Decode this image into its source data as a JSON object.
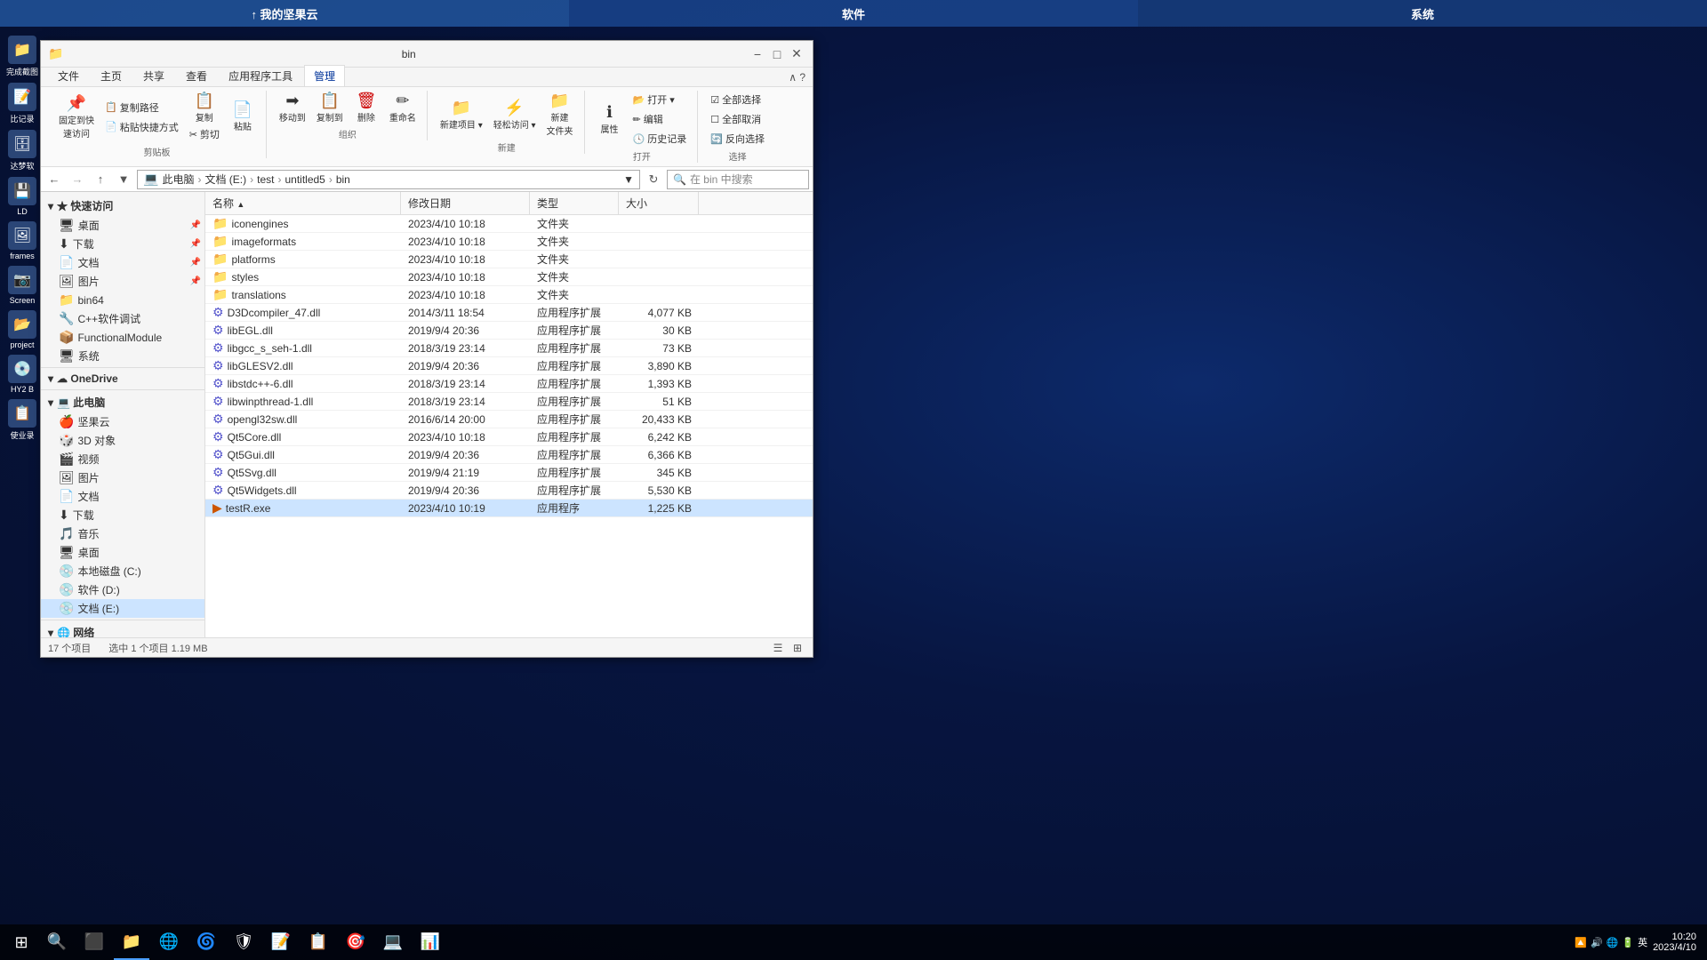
{
  "desktop": {
    "bg_gradient": "radial-gradient(ellipse at 70% 40%, #0d2a6b 0%, #071540 40%, #050e2a 100%)"
  },
  "taskbar_top": {
    "items": [
      {
        "label": "↑ 我的坚果云",
        "class": "jianguoyun"
      },
      {
        "label": "软件",
        "class": "software"
      },
      {
        "label": "系统",
        "class": "system"
      }
    ]
  },
  "desktop_icons": [
    {
      "icon": "📁",
      "label": "完成截图"
    },
    {
      "icon": "🔤",
      "label": "比记录"
    },
    {
      "icon": "💾",
      "label": "达梦软"
    },
    {
      "icon": "📂",
      "label": "LD"
    },
    {
      "icon": "🖼",
      "label": "frames"
    },
    {
      "icon": "📷",
      "label": "Screen"
    },
    {
      "icon": "📁",
      "label": "project"
    },
    {
      "icon": "💿",
      "label": "HY2 B"
    },
    {
      "icon": "💻",
      "label": "使业录"
    }
  ],
  "window": {
    "title": "bin",
    "ribbon": {
      "tabs": [
        "文件",
        "主页",
        "共享",
        "查看",
        "应用程序工具",
        "管理"
      ],
      "active_tab": "管理",
      "groups": [
        {
          "label": "剪贴板",
          "buttons": [
            {
              "icon": "📌",
              "label": "固定到快\n速访问"
            },
            {
              "icon": "📋",
              "label": "复制"
            },
            {
              "icon": "📄",
              "label": "粘贴"
            }
          ]
        },
        {
          "label": "组织",
          "buttons": [
            {
              "icon": "→📁",
              "label": "移动到"
            },
            {
              "icon": "📋→",
              "label": "复制到"
            },
            {
              "icon": "🗑",
              "label": "删除"
            },
            {
              "icon": "✏",
              "label": "重命名"
            }
          ]
        },
        {
          "label": "新建",
          "buttons": [
            {
              "icon": "📁+",
              "label": "新建\n文件夹"
            }
          ]
        },
        {
          "label": "打开",
          "buttons": [
            {
              "icon": "📂",
              "label": "打开▾"
            },
            {
              "icon": "✏",
              "label": "编辑"
            },
            {
              "icon": "🕓",
              "label": "历史记录"
            }
          ]
        },
        {
          "label": "选择",
          "buttons": [
            {
              "icon": "☑",
              "label": "全部选择"
            },
            {
              "icon": "☐",
              "label": "全部取消"
            },
            {
              "icon": "🔄",
              "label": "反向选择"
            }
          ]
        }
      ]
    },
    "address_bar": {
      "path": [
        "此电脑",
        "文档 (E:)",
        "test",
        "untitled5",
        "bin"
      ],
      "search_placeholder": "在 bin 中搜索"
    },
    "nav_pane": {
      "sections": [
        {
          "label": "★ 快速访问",
          "items": [
            {
              "icon": "🖥",
              "label": "桌面",
              "pinned": true
            },
            {
              "icon": "⬇",
              "label": "下载",
              "pinned": true
            },
            {
              "icon": "📄",
              "label": "文档",
              "pinned": true
            },
            {
              "icon": "🖼",
              "label": "图片",
              "pinned": true
            },
            {
              "icon": "📁",
              "label": "bin64"
            },
            {
              "icon": "🔧",
              "label": "C++软件调试"
            },
            {
              "icon": "📦",
              "label": "FunctionalModule"
            },
            {
              "icon": "🖥",
              "label": "系统"
            }
          ]
        },
        {
          "label": "☁ OneDrive",
          "items": []
        },
        {
          "label": "💻 此电脑",
          "items": [
            {
              "icon": "🍎",
              "label": "坚果云"
            },
            {
              "icon": "🎲",
              "label": "3D 对象"
            },
            {
              "icon": "🎬",
              "label": "视频"
            },
            {
              "icon": "🖼",
              "label": "图片"
            },
            {
              "icon": "📄",
              "label": "文档"
            },
            {
              "icon": "⬇",
              "label": "下载"
            },
            {
              "icon": "🎵",
              "label": "音乐"
            },
            {
              "icon": "🖥",
              "label": "桌面"
            },
            {
              "icon": "💿",
              "label": "本地磁盘 (C:)"
            },
            {
              "icon": "💿",
              "label": "软件 (D:)"
            },
            {
              "icon": "💿",
              "label": "文档 (E:)",
              "selected": true
            }
          ]
        },
        {
          "label": "🌐 网络",
          "items": []
        }
      ]
    },
    "file_list": {
      "columns": [
        "名称",
        "修改日期",
        "类型",
        "大小"
      ],
      "files": [
        {
          "icon": "📁",
          "name": "iconengines",
          "date": "2023/4/10 10:18",
          "type": "文件夹",
          "size": "",
          "type_class": "folder"
        },
        {
          "icon": "📁",
          "name": "imageformats",
          "date": "2023/4/10 10:18",
          "type": "文件夹",
          "size": "",
          "type_class": "folder"
        },
        {
          "icon": "📁",
          "name": "platforms",
          "date": "2023/4/10 10:18",
          "type": "文件夹",
          "size": "",
          "type_class": "folder"
        },
        {
          "icon": "📁",
          "name": "styles",
          "date": "2023/4/10 10:18",
          "type": "文件夹",
          "size": "",
          "type_class": "folder"
        },
        {
          "icon": "📁",
          "name": "translations",
          "date": "2023/4/10 10:18",
          "type": "文件夹",
          "size": "",
          "type_class": "folder"
        },
        {
          "icon": "⚙",
          "name": "D3Dcompiler_47.dll",
          "date": "2014/3/11 18:54",
          "type": "应用程序扩展",
          "size": "4,077 KB",
          "type_class": "dll"
        },
        {
          "icon": "⚙",
          "name": "libEGL.dll",
          "date": "2019/9/4 20:36",
          "type": "应用程序扩展",
          "size": "30 KB",
          "type_class": "dll"
        },
        {
          "icon": "⚙",
          "name": "libgcc_s_seh-1.dll",
          "date": "2018/3/19 23:14",
          "type": "应用程序扩展",
          "size": "73 KB",
          "type_class": "dll"
        },
        {
          "icon": "⚙",
          "name": "libGLESV2.dll",
          "date": "2019/9/4 20:36",
          "type": "应用程序扩展",
          "size": "3,890 KB",
          "type_class": "dll"
        },
        {
          "icon": "⚙",
          "name": "libstdc++-6.dll",
          "date": "2018/3/19 23:14",
          "type": "应用程序扩展",
          "size": "1,393 KB",
          "type_class": "dll"
        },
        {
          "icon": "⚙",
          "name": "libwinpthread-1.dll",
          "date": "2018/3/19 23:14",
          "type": "应用程序扩展",
          "size": "51 KB",
          "type_class": "dll"
        },
        {
          "icon": "⚙",
          "name": "opengl32sw.dll",
          "date": "2016/6/14 20:00",
          "type": "应用程序扩展",
          "size": "20,433 KB",
          "type_class": "dll"
        },
        {
          "icon": "⚙",
          "name": "Qt5Core.dll",
          "date": "2023/4/10 10:18",
          "type": "应用程序扩展",
          "size": "6,242 KB",
          "type_class": "dll"
        },
        {
          "icon": "⚙",
          "name": "Qt5Gui.dll",
          "date": "2019/9/4 20:36",
          "type": "应用程序扩展",
          "size": "6,366 KB",
          "type_class": "dll"
        },
        {
          "icon": "⚙",
          "name": "Qt5Svg.dll",
          "date": "2019/9/4 21:19",
          "type": "应用程序扩展",
          "size": "345 KB",
          "type_class": "dll"
        },
        {
          "icon": "⚙",
          "name": "Qt5Widgets.dll",
          "date": "2019/9/4 20:36",
          "type": "应用程序扩展",
          "size": "5,530 KB",
          "type_class": "dll"
        },
        {
          "icon": "▶",
          "name": "testR.exe",
          "date": "2023/4/10 10:19",
          "type": "应用程序",
          "size": "1,225 KB",
          "type_class": "exe",
          "selected": true
        }
      ]
    },
    "status_bar": {
      "item_count": "17 个项目",
      "selected_info": "选中 1 个项目  1.19 MB"
    }
  },
  "taskbar_bottom": {
    "apps": [
      {
        "icon": "⊞",
        "label": "start",
        "type": "start"
      },
      {
        "icon": "🔍",
        "label": "search"
      },
      {
        "icon": "⬛",
        "label": "taskview"
      },
      {
        "icon": "📁",
        "label": "explorer",
        "active": true
      },
      {
        "icon": "🌐",
        "label": "chrome"
      },
      {
        "icon": "🌐",
        "label": "edge"
      },
      {
        "icon": "🛡",
        "label": "security"
      },
      {
        "icon": "📝",
        "label": "typora"
      },
      {
        "icon": "📋",
        "label": "clipboard"
      },
      {
        "icon": "🎯",
        "label": "app1"
      },
      {
        "icon": "💻",
        "label": "terminal"
      },
      {
        "icon": "📊",
        "label": "app2"
      }
    ],
    "systray": {
      "icons": [
        "🔼",
        "🔊",
        "🌐",
        "🔋"
      ],
      "language": "英",
      "time": "10:20",
      "date": "2023/4/10"
    }
  }
}
